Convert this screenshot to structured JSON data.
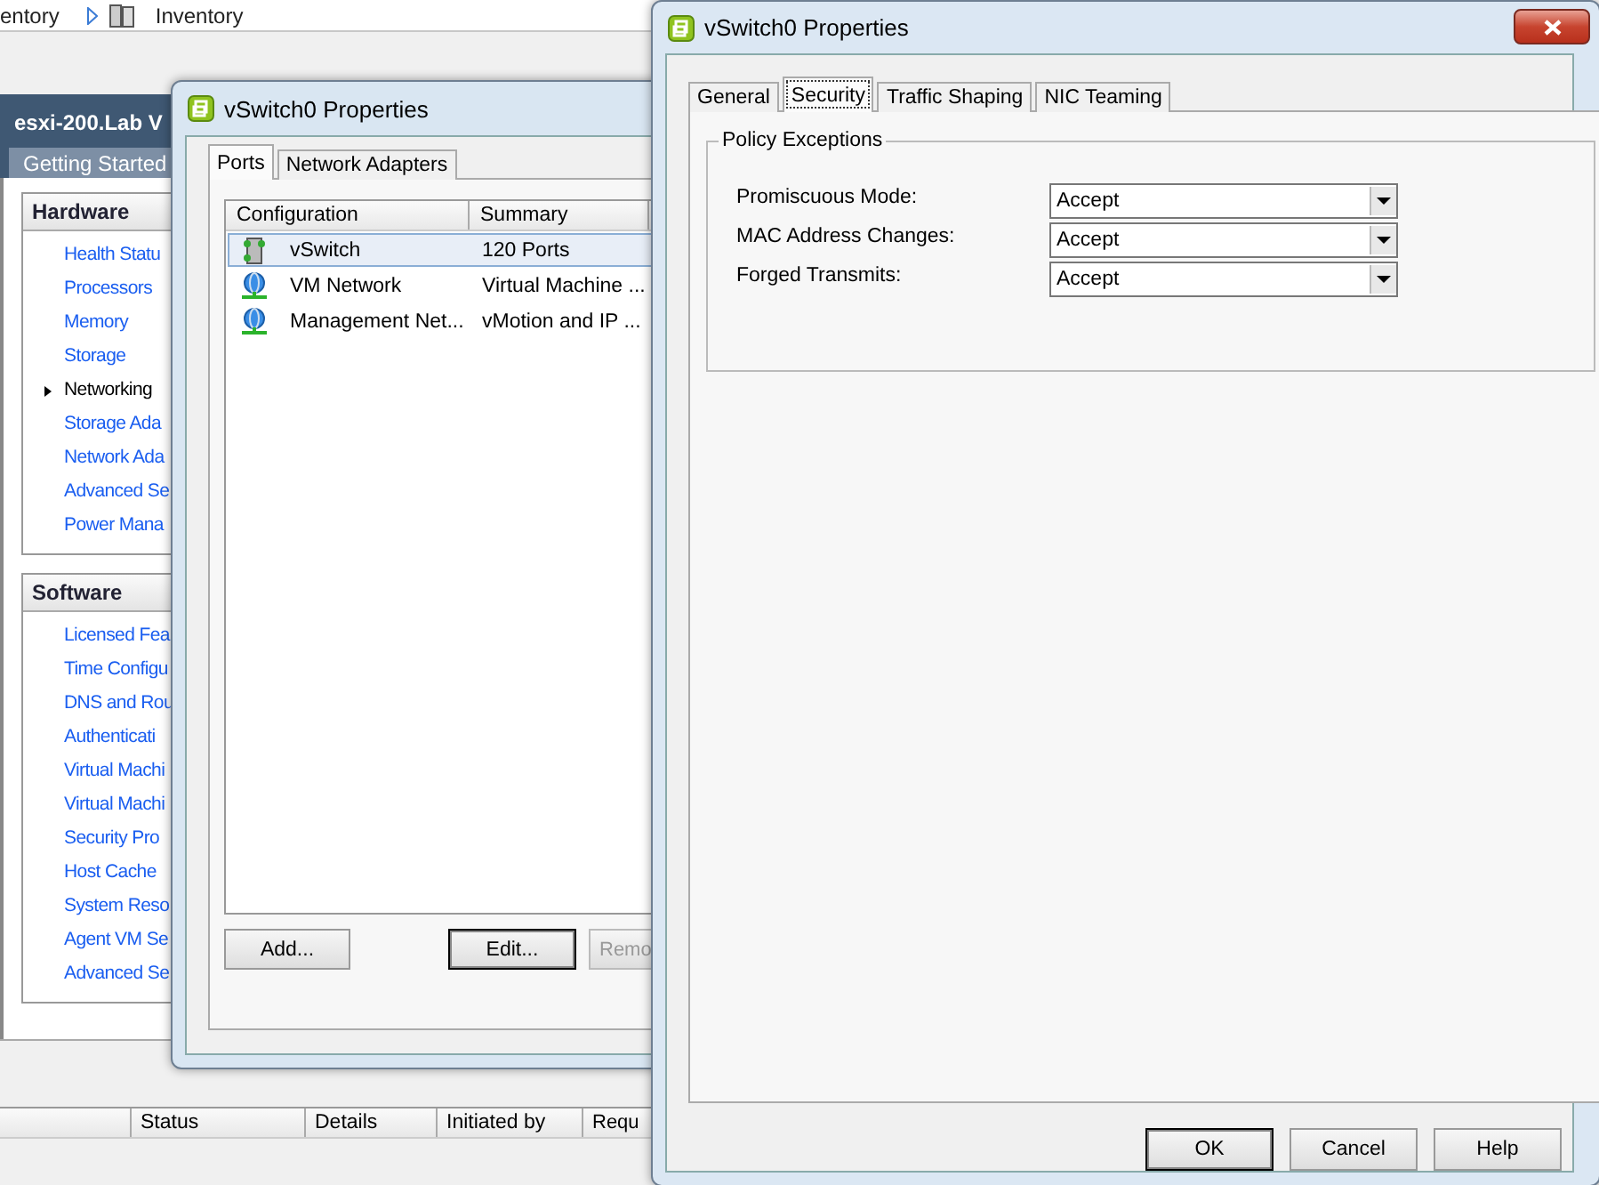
{
  "background_app": {
    "breadcrumb": [
      "entory",
      "Inventory"
    ],
    "host_title": "esxi-200.Lab V",
    "tab": "Getting Started",
    "panels": [
      {
        "title": "Hardware",
        "items": [
          {
            "label": "Health Statu",
            "selected": false
          },
          {
            "label": "Processors",
            "selected": false
          },
          {
            "label": "Memory",
            "selected": false
          },
          {
            "label": "Storage",
            "selected": false
          },
          {
            "label": "Networking",
            "selected": true
          },
          {
            "label": "Storage Ada",
            "selected": false
          },
          {
            "label": "Network Ada",
            "selected": false
          },
          {
            "label": "Advanced Se",
            "selected": false
          },
          {
            "label": "Power Mana",
            "selected": false
          }
        ]
      },
      {
        "title": "Software",
        "items": [
          {
            "label": "Licensed Fea",
            "selected": false
          },
          {
            "label": "Time Configu",
            "selected": false
          },
          {
            "label": "DNS and Rou",
            "selected": false
          },
          {
            "label": "Authenticati",
            "selected": false
          },
          {
            "label": "Virtual Machi",
            "selected": false
          },
          {
            "label": "Virtual Machi",
            "selected": false
          },
          {
            "label": "Security Pro",
            "selected": false
          },
          {
            "label": "Host Cache",
            "selected": false
          },
          {
            "label": "System Reso",
            "selected": false
          },
          {
            "label": "Agent VM Se",
            "selected": false
          },
          {
            "label": "Advanced Se",
            "selected": false
          }
        ]
      }
    ],
    "tasks_columns": [
      "Status",
      "Details",
      "Initiated by",
      "Requ"
    ]
  },
  "back_dialog": {
    "title": "vSwitch0 Properties",
    "tabs": [
      {
        "label": "Ports",
        "selected": true
      },
      {
        "label": "Network Adapters",
        "selected": false
      }
    ],
    "columns": [
      "Configuration",
      "Summary"
    ],
    "rows": [
      {
        "kind": "switch",
        "name": "vSwitch",
        "summary": "120 Ports",
        "selected": true
      },
      {
        "kind": "network",
        "name": "VM Network",
        "summary": "Virtual Machine ...",
        "selected": false
      },
      {
        "kind": "network",
        "name": "Management Net...",
        "summary": "vMotion and IP ...",
        "selected": false
      }
    ],
    "buttons": [
      {
        "label": "Add...",
        "default": false,
        "disabled": false
      },
      {
        "label": "Edit...",
        "default": true,
        "disabled": false
      },
      {
        "label": "Remo",
        "default": false,
        "disabled": true
      }
    ]
  },
  "window": {
    "title": "vSwitch0 Properties",
    "tabs": [
      {
        "label": "General",
        "selected": false
      },
      {
        "label": "Security",
        "selected": true
      },
      {
        "label": "Traffic Shaping",
        "selected": false
      },
      {
        "label": "NIC Teaming",
        "selected": false
      }
    ],
    "group": {
      "title": "Policy Exceptions",
      "fields": [
        {
          "label": "Promiscuous Mode:",
          "value": "Accept"
        },
        {
          "label": "MAC Address Changes:",
          "value": "Accept"
        },
        {
          "label": "Forged Transmits:",
          "value": "Accept"
        }
      ]
    },
    "buttons": [
      {
        "label": "OK",
        "default": true
      },
      {
        "label": "Cancel",
        "default": false
      },
      {
        "label": "Help",
        "default": false
      }
    ]
  }
}
